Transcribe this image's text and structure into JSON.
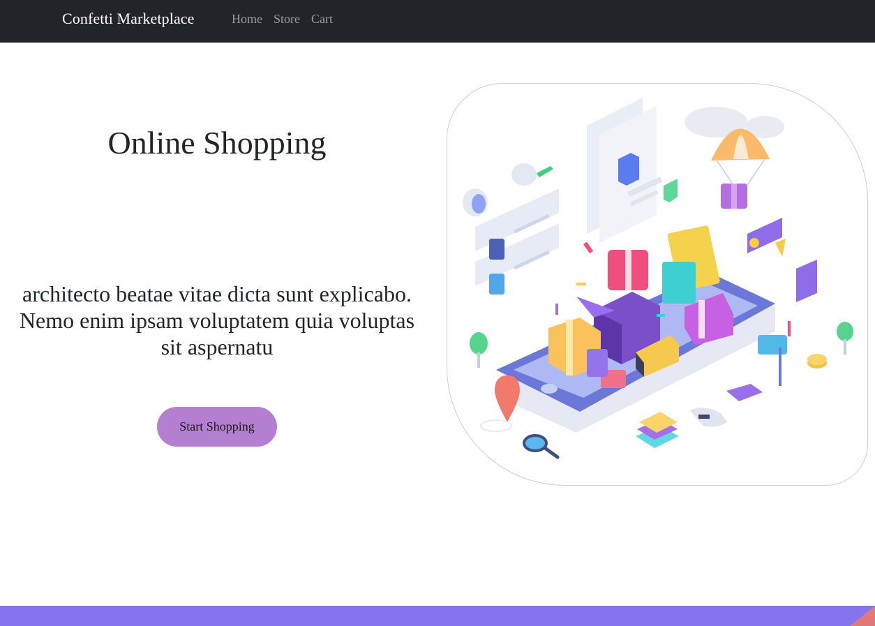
{
  "navbar": {
    "brand": "Confetti Marketplace",
    "links": [
      {
        "label": "Home"
      },
      {
        "label": "Store"
      },
      {
        "label": "Cart"
      }
    ],
    "bg_color": "#212529"
  },
  "hero": {
    "title": "Online Shopping",
    "description": "architecto beatae vitae dicta sunt explicabo. Nemo enim ipsam voluptatem quia voluptas sit aspernatu",
    "cta_label": "Start Shopping",
    "cta_color": "#b57fd1"
  },
  "illustration": {
    "icon": "isometric-online-shopping-illustration"
  },
  "footer": {
    "band_color": "#8673ee",
    "accent_color": "#e07a7a"
  }
}
